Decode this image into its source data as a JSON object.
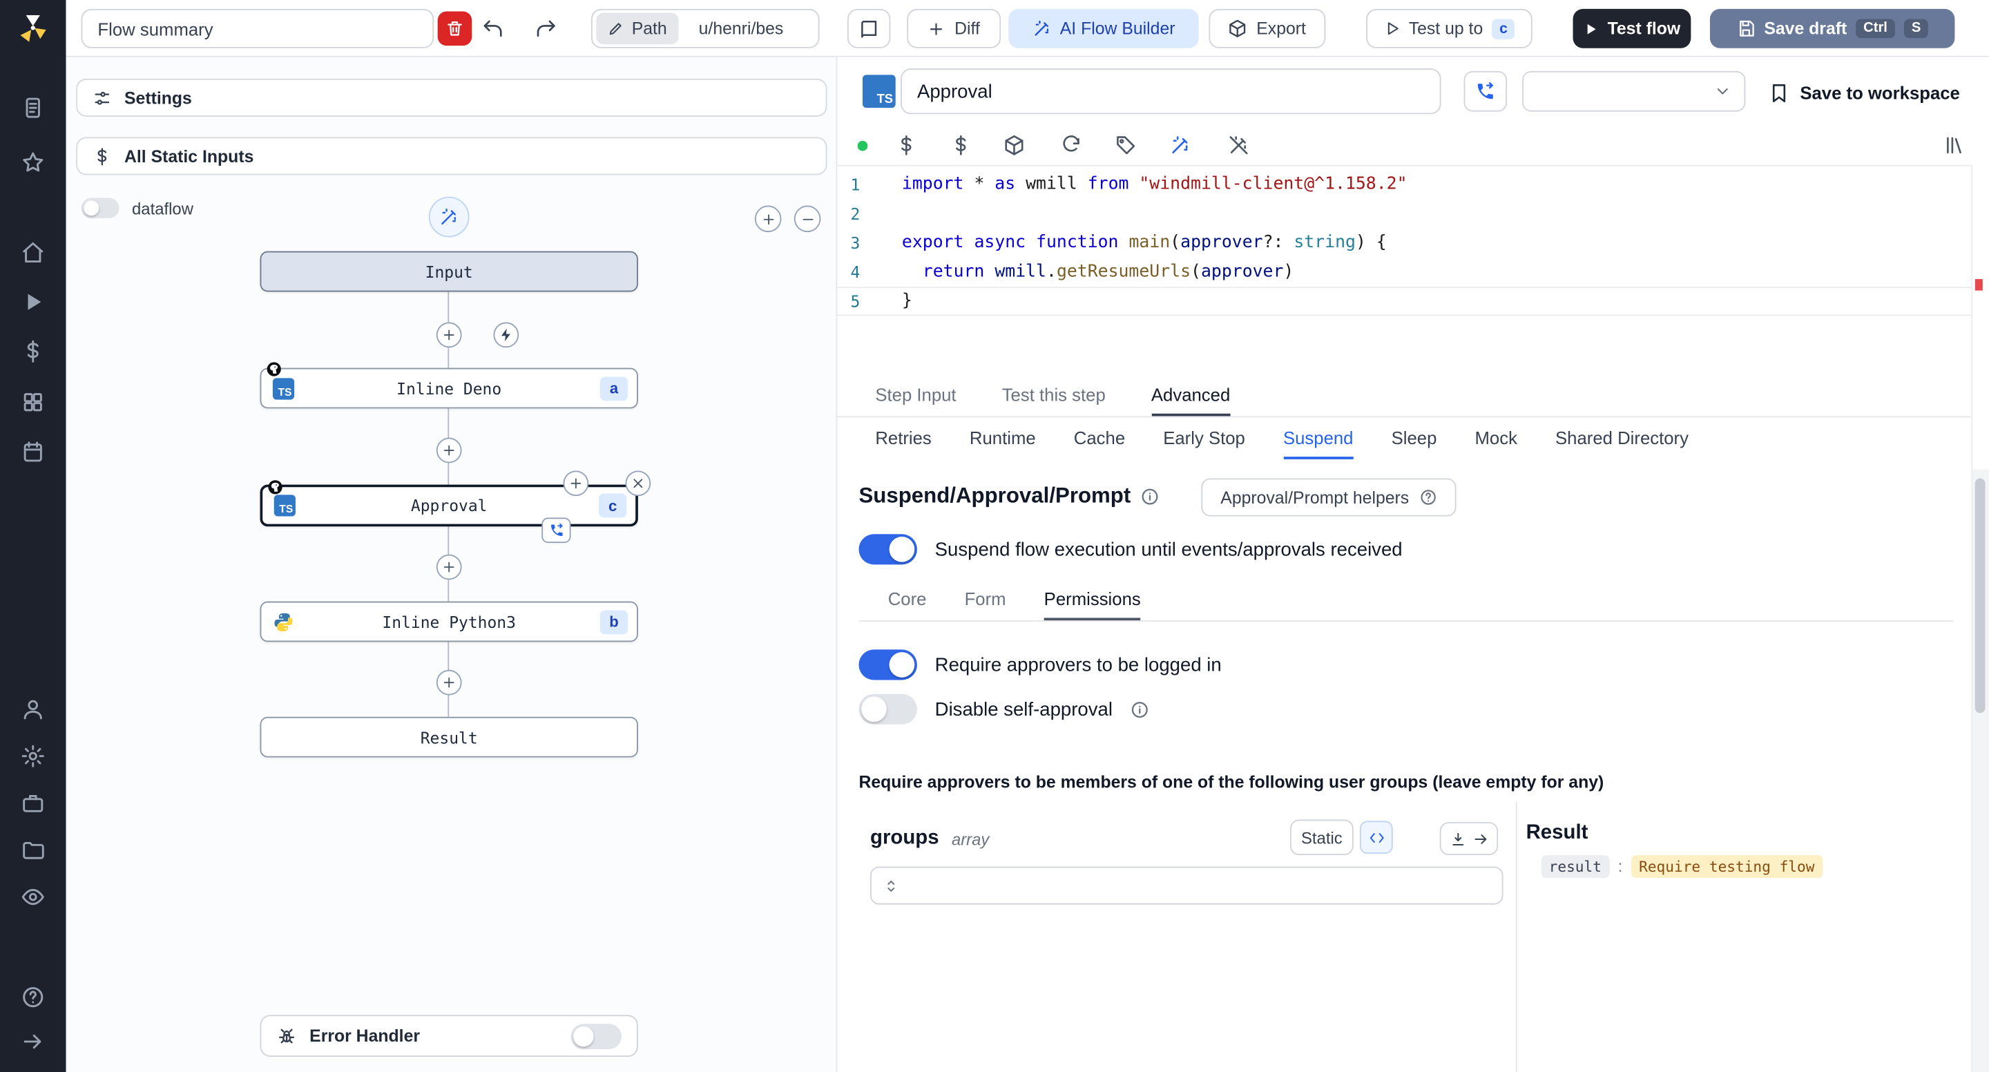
{
  "topbar": {
    "flow_summary_value": "Flow summary",
    "path_label": "Path",
    "path_value": "u/henri/bes",
    "diff_label": "Diff",
    "ai_builder_label": "AI Flow Builder",
    "export_label": "Export",
    "test_up_to_label": "Test up to",
    "test_up_to_badge": "c",
    "test_flow_label": "Test flow",
    "save_draft_label": "Save draft",
    "save_draft_kbd": [
      "Ctrl",
      "S"
    ]
  },
  "flow_panel": {
    "settings_label": "Settings",
    "static_inputs_label": "All Static Inputs",
    "dataflow_label": "dataflow",
    "nodes": [
      {
        "label": "Input",
        "badge": ""
      },
      {
        "label": "Inline Deno",
        "badge": "a"
      },
      {
        "label": "Approval",
        "badge": "c"
      },
      {
        "label": "Inline Python3",
        "badge": "b"
      },
      {
        "label": "Result",
        "badge": ""
      }
    ],
    "error_handler_label": "Error Handler"
  },
  "step_header": {
    "name_value": "Approval",
    "save_to_workspace_label": "Save to workspace"
  },
  "editor": {
    "language_label": "TS",
    "current_line": 5,
    "lines": [
      [
        {
          "t": "import",
          "c": "kw"
        },
        {
          "t": " * ",
          "c": "pl"
        },
        {
          "t": "as",
          "c": "kw"
        },
        {
          "t": " wmill ",
          "c": "pl"
        },
        {
          "t": "from",
          "c": "kw"
        },
        {
          "t": " ",
          "c": "pl"
        },
        {
          "t": "\"windmill-client@^1.158.2\"",
          "c": "str"
        }
      ],
      [],
      [
        {
          "t": "export",
          "c": "kw"
        },
        {
          "t": " ",
          "c": "pl"
        },
        {
          "t": "async",
          "c": "kw"
        },
        {
          "t": " ",
          "c": "pl"
        },
        {
          "t": "function",
          "c": "kw"
        },
        {
          "t": " ",
          "c": "pl"
        },
        {
          "t": "main",
          "c": "fn"
        },
        {
          "t": "(",
          "c": "pl"
        },
        {
          "t": "approver",
          "c": "var"
        },
        {
          "t": "?: ",
          "c": "pl"
        },
        {
          "t": "string",
          "c": "ty"
        },
        {
          "t": ") {",
          "c": "pl"
        }
      ],
      [
        {
          "t": "  ",
          "c": "pl"
        },
        {
          "t": "return",
          "c": "kw"
        },
        {
          "t": " ",
          "c": "pl"
        },
        {
          "t": "wmill",
          "c": "var"
        },
        {
          "t": ".",
          "c": "pl"
        },
        {
          "t": "getResumeUrls",
          "c": "fn"
        },
        {
          "t": "(",
          "c": "pl"
        },
        {
          "t": "approver",
          "c": "var"
        },
        {
          "t": ")",
          "c": "pl"
        }
      ],
      [
        {
          "t": "}",
          "c": "pl"
        }
      ]
    ]
  },
  "panel_tabs": {
    "items": [
      "Step Input",
      "Test this step",
      "Advanced"
    ],
    "active": "Advanced"
  },
  "advanced_tabs": {
    "items": [
      "Retries",
      "Runtime",
      "Cache",
      "Early Stop",
      "Suspend",
      "Sleep",
      "Mock",
      "Shared Directory"
    ],
    "active": "Suspend"
  },
  "suspend_section": {
    "title": "Suspend/Approval/Prompt",
    "helpers_button_label": "Approval/Prompt helpers",
    "suspend_toggle_label": "Suspend flow execution until events/approvals received",
    "sub_tabs": {
      "items": [
        "Core",
        "Form",
        "Permissions"
      ],
      "active": "Permissions"
    },
    "require_login_label": "Require approvers to be logged in",
    "disable_self_approval_label": "Disable self-approval",
    "groups_heading": "Require approvers to be members of one of the following user groups (leave empty for any)",
    "groups_field_name": "groups",
    "groups_field_type": "array",
    "static_button_label": "Static",
    "result_title": "Result",
    "result_key": "result",
    "result_separator": ":",
    "result_value": "Require testing flow"
  },
  "colors": {
    "accent": "#2563eb",
    "accent_light": "#dbeafe",
    "danger": "#dc2626",
    "dark_button": "#20242e",
    "save_draft_button": "#68799a",
    "result_highlight": "#fdf0c5"
  }
}
